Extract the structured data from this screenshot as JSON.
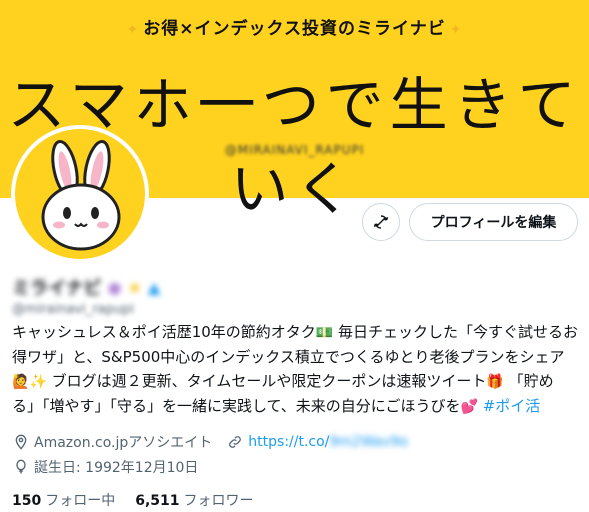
{
  "banner": {
    "subtitle": "お得×インデックス投資のミライナビ",
    "title": "スマホ一つで生きていく",
    "handle": "@MIRAINAVI_RAPUPI"
  },
  "profile": {
    "display_name": "ミライナビ",
    "handle": "@mirainavi_rapupi",
    "edit_button": "プロフィールを編集",
    "bio": {
      "line1": "キャッシュレス＆ポイ活歴10年の節約オタク",
      "line1b": " 毎日チェックした「今すぐ試せるお",
      "line2": "得ワザ」と、S&P500中心のインデックス積立でつくるゆとり老後プランをシェア",
      "line3a": " ブログは週２更新、タイムセールや限定クーポンは速報ツイート",
      "line3b": " 「貯め",
      "line4a": "る」「増やす」「守る」を一緒に実践して、未来の自分にごほうびを",
      "hashtag": "#ポイ活"
    },
    "meta": {
      "affiliation": "Amazon.co.jpアソシエイト",
      "link": "https://t.co/",
      "link_rest": "9m2Wav9o",
      "birthday": "誕生日: 1992年12月10日"
    },
    "stats": {
      "following_count": "150",
      "following_label": "フォロー中",
      "followers_count": "6,511",
      "followers_label": "フォロワー"
    }
  },
  "icons": [
    "rabbit-avatar",
    "sync-icon",
    "location-icon",
    "link-icon",
    "balloon-icon",
    "money-emoji",
    "person-emoji",
    "sparkle-emoji",
    "gift-emoji",
    "hearts-emoji"
  ],
  "colors": {
    "banner": "#FFD21F",
    "link": "#1d9bf0",
    "secondary_text": "#536471"
  }
}
